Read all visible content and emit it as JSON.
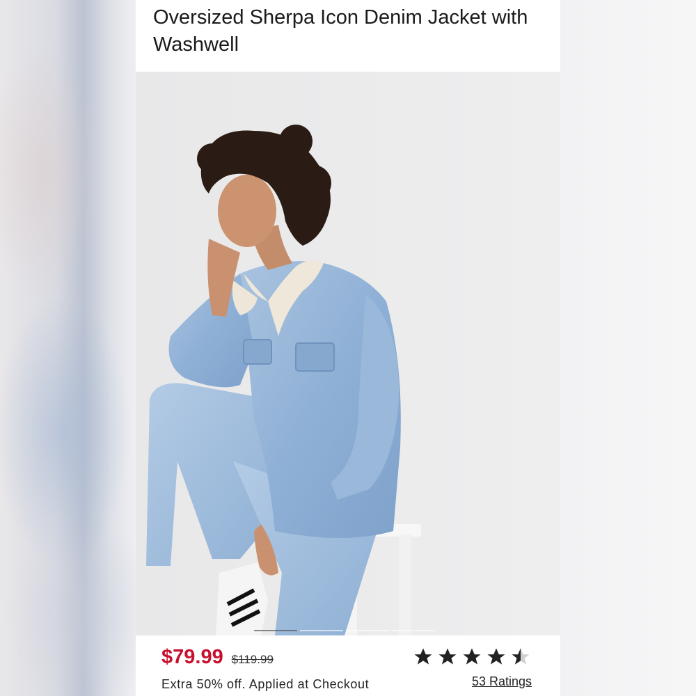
{
  "product": {
    "title": "Oversized Sherpa Icon Denim Jacket with Washwell",
    "image_alt": "model-wearing-denim-jacket"
  },
  "pricing": {
    "sale_price": "$79.99",
    "original_price": "$119.99",
    "promo_text": "Extra 50% off. Applied at Checkout"
  },
  "rating": {
    "value": 4.5,
    "max": 5,
    "count_label": "53 Ratings"
  },
  "carousel": {
    "slide_count": 4,
    "active_index": 0
  },
  "colors": {
    "sale_price": "#c8102e",
    "star": "#222222"
  }
}
